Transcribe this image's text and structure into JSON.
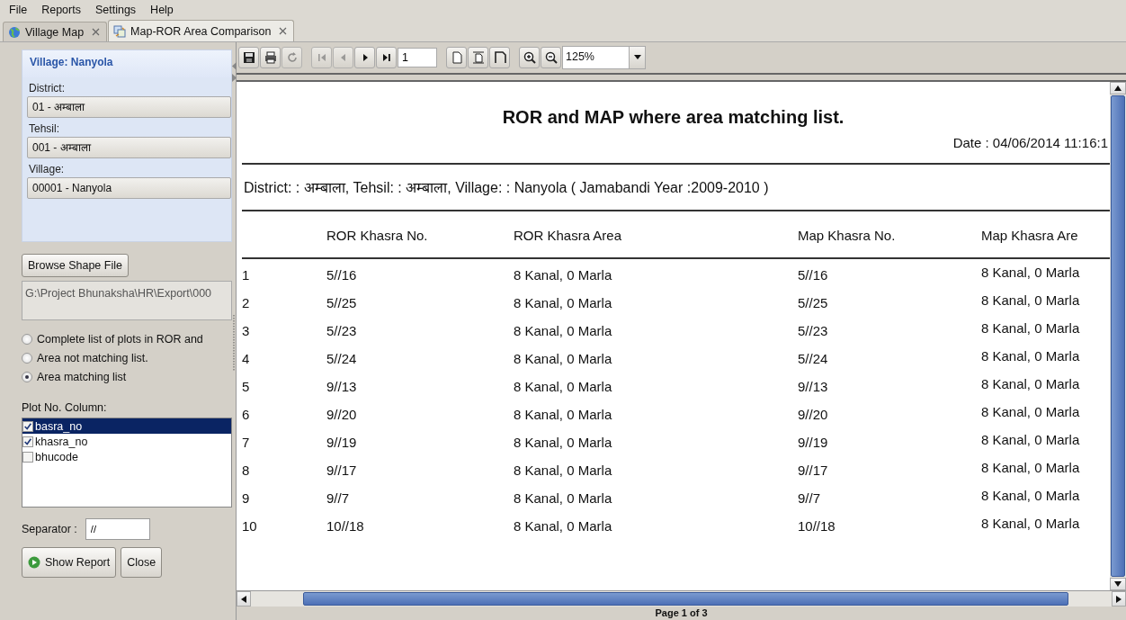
{
  "menu": [
    "File",
    "Reports",
    "Settings",
    "Help"
  ],
  "tabs": [
    {
      "label": "Village Map",
      "selected": false
    },
    {
      "label": "Map-ROR Area Comparison",
      "selected": true
    }
  ],
  "left_panel": {
    "header": "Village: Nanyola",
    "fields": [
      {
        "label": "District:",
        "value": "01 - अम्बाला"
      },
      {
        "label": "Tehsil:",
        "value": "001 - अम्बाला"
      },
      {
        "label": "Village:",
        "value": "00001 - Nanyola"
      }
    ],
    "browse_button": "Browse Shape File",
    "path": "G:\\Project Bhunaksha\\HR\\Export\\000",
    "report_options": [
      {
        "label": "Complete list of plots in ROR and",
        "selected": false
      },
      {
        "label": "Area not matching list.",
        "selected": false
      },
      {
        "label": "Area matching list",
        "selected": true
      }
    ],
    "plot_columns": {
      "label": "Plot No. Column:",
      "items": [
        {
          "label": "basra_no",
          "checked": true,
          "selected": true
        },
        {
          "label": "khasra_no",
          "checked": true,
          "selected": false
        },
        {
          "label": "bhucode",
          "checked": false,
          "selected": false
        }
      ]
    },
    "separator": {
      "label": "Separator :",
      "value": "//"
    },
    "buttons": [
      {
        "label": "Show Report",
        "kind": "run"
      },
      {
        "label": "Close",
        "kind": "plain"
      }
    ]
  },
  "viewer": {
    "toolbar": [
      [
        {
          "kind": "save",
          "disabled": false
        },
        {
          "kind": "print",
          "disabled": false
        },
        {
          "kind": "refresh",
          "disabled": true
        }
      ],
      [
        {
          "kind": "first",
          "disabled": true
        },
        {
          "kind": "prev",
          "disabled": true
        },
        {
          "kind": "next",
          "disabled": false
        },
        {
          "kind": "last",
          "disabled": false
        },
        {
          "kind": "page_field",
          "value": "1"
        }
      ],
      [
        {
          "kind": "actual_size",
          "disabled": false
        },
        {
          "kind": "fit_width",
          "disabled": false
        },
        {
          "kind": "fit_page",
          "disabled": false
        }
      ],
      [
        {
          "kind": "zoom_in",
          "disabled": false
        },
        {
          "kind": "zoom_out",
          "disabled": false
        },
        {
          "kind": "zoom_combo",
          "value": "125%"
        }
      ]
    ],
    "report": {
      "title": "ROR and MAP where area matching list.",
      "date": "Date : 04/06/2014 11:16:1",
      "filter": "District: : अम्बाला, Tehsil: : अम्बाला, Village: : Nanyola  ( Jamabandi Year :2009-2010 )",
      "columns": [
        "",
        "ROR Khasra No.",
        "ROR Khasra Area",
        "Map Khasra No.",
        "Map Khasra Are"
      ],
      "rows": [
        [
          "1",
          "5//16",
          "8 Kanal, 0 Marla",
          "5//16",
          "8 Kanal, 0 Marla"
        ],
        [
          "2",
          "5//25",
          "8 Kanal, 0 Marla",
          "5//25",
          "8 Kanal, 0 Marla"
        ],
        [
          "3",
          "5//23",
          "8 Kanal, 0 Marla",
          "5//23",
          "8 Kanal, 0 Marla"
        ],
        [
          "4",
          "5//24",
          "8 Kanal, 0 Marla",
          "5//24",
          "8 Kanal, 0 Marla"
        ],
        [
          "5",
          "9//13",
          "8 Kanal, 0 Marla",
          "9//13",
          "8 Kanal, 0 Marla"
        ],
        [
          "6",
          "9//20",
          "8 Kanal, 0 Marla",
          "9//20",
          "8 Kanal, 0 Marla"
        ],
        [
          "7",
          "9//19",
          "8 Kanal, 0 Marla",
          "9//19",
          "8 Kanal, 0 Marla"
        ],
        [
          "8",
          "9//17",
          "8 Kanal, 0 Marla",
          "9//17",
          "8 Kanal, 0 Marla"
        ],
        [
          "9",
          "9//7",
          "8 Kanal, 0 Marla",
          "9//7",
          "8 Kanal, 0 Marla"
        ],
        [
          "10",
          "10//18",
          "8 Kanal, 0 Marla",
          "10//18",
          "8 Kanal, 0 Marla"
        ]
      ]
    },
    "status": "Page 1 of 3"
  }
}
